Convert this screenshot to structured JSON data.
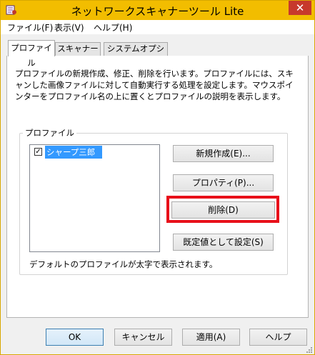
{
  "window": {
    "title": "ネットワークスキャナーツール Lite",
    "close_glyph": "✕"
  },
  "menu": {
    "items": [
      "ファイル(F)",
      "表示(V)",
      "ヘルプ(H)"
    ]
  },
  "tabs": [
    {
      "label": "プロファイル",
      "active": true
    },
    {
      "label": "スキャナー",
      "active": false
    },
    {
      "label": "システムオプション",
      "active": false
    }
  ],
  "profile_tab": {
    "description": "プロファイルの新規作成、修正、削除を行います。プロファイルには、スキャンした画像ファイルに対して自動実行する処理を設定します。マウスポインターをプロファイル名の上に置くとプロファイルの説明を表示します。",
    "group_label": "プロファイル",
    "profiles": [
      {
        "name": "シャープ三郎",
        "checked": true,
        "selected": true
      }
    ],
    "check_glyph": "✓",
    "buttons": {
      "new": "新規作成(E)...",
      "properties": "プロパティ(P)...",
      "delete": "削除(D)",
      "set_default": "既定値として設定(S)"
    },
    "note": "デフォルトのプロファイルが太字で表示されます。"
  },
  "dialog_buttons": {
    "ok": "OK",
    "cancel": "キャンセル",
    "apply": "適用(A)",
    "help": "ヘルプ"
  },
  "colors": {
    "titlebar": "#f2bd00",
    "close_button": "#c7392c",
    "selection": "#3399ff",
    "highlight_box": "#e8101a"
  }
}
